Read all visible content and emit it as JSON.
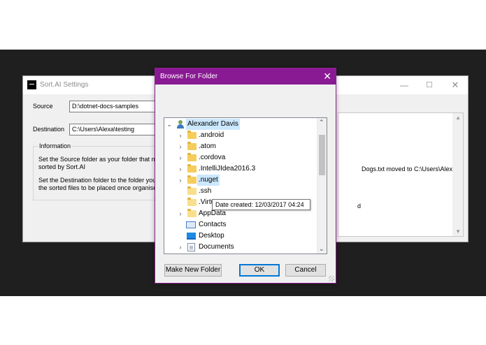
{
  "settings_window": {
    "title": "Sort.AI Settings",
    "minimize": "—",
    "maximize": "☐",
    "close": "✕",
    "source_label": "Source",
    "source_value": "D:\\dotnet-docs-samples",
    "destination_label": "Destination",
    "destination_value": "C:\\Users\\Alexa\\testing",
    "info_title": "Information",
    "info_line1": "Set the Source folder as your folder that nee",
    "info_line2": "sorted by Sort.AI",
    "info_line3": "Set the Destination folder to the folder you v",
    "info_line4": "the sorted files to be placed once organised",
    "log_line1": "Dogs.txt moved to C:\\Users\\Alexa",
    "log_line2": "d"
  },
  "dialog": {
    "title": "Browse For Folder",
    "close": "✕",
    "tree": {
      "root": "Alexander Davis",
      "items": [
        {
          "label": ".android",
          "expandable": true
        },
        {
          "label": ".atom",
          "expandable": true
        },
        {
          "label": ".cordova",
          "expandable": true
        },
        {
          "label": ".IntelliJIdea2016.3",
          "expandable": true
        },
        {
          "label": ".nuget",
          "expandable": true
        },
        {
          "label": ".ssh",
          "expandable": false
        },
        {
          "label": ".Virtu",
          "expandable": false
        },
        {
          "label": "AppData",
          "expandable": true
        },
        {
          "label": "Contacts",
          "expandable": false
        },
        {
          "label": "Desktop",
          "expandable": false
        },
        {
          "label": "Documents",
          "expandable": true
        }
      ]
    },
    "tooltip": "Date created: 12/03/2017 04:24",
    "make_new_folder": "Make New Folder",
    "ok": "OK",
    "cancel": "Cancel"
  },
  "colors": {
    "dialog_accent": "#891a93",
    "hover_highlight": "#cce8ff",
    "folder": "#f5cd5c"
  }
}
